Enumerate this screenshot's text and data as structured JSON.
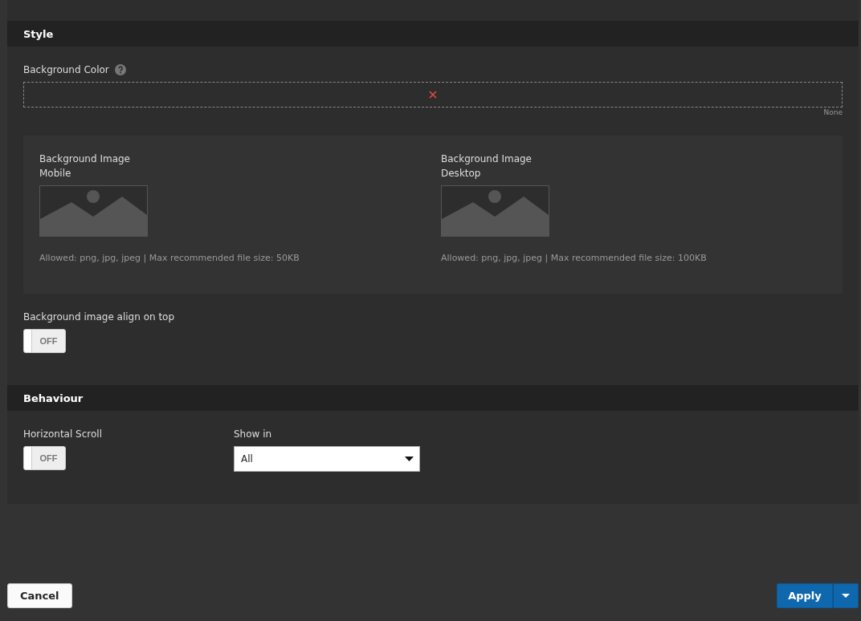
{
  "sections": [
    {
      "kind": "style",
      "title": "Style",
      "background_color": {
        "label": "Background Color",
        "value": "None"
      },
      "images": [
        {
          "title": "Background Image",
          "subtitle": "Mobile",
          "hint": "Allowed: png, jpg, jpeg | Max recommended file size: 50KB"
        },
        {
          "title": "Background Image",
          "subtitle": "Desktop",
          "hint": "Allowed: png, jpg, jpeg | Max recommended file size: 100KB"
        }
      ],
      "toggle": {
        "label": "Background image align on top",
        "on": false,
        "state_text": "OFF"
      }
    },
    {
      "kind": "behaviour",
      "title": "Behaviour",
      "toggle": {
        "label": "Horizontal Scroll",
        "on": false,
        "state_text": "OFF"
      },
      "select": {
        "label": "Show in",
        "value": "All"
      }
    }
  ],
  "buttons": {
    "cancel": "Cancel",
    "apply": "Apply"
  }
}
